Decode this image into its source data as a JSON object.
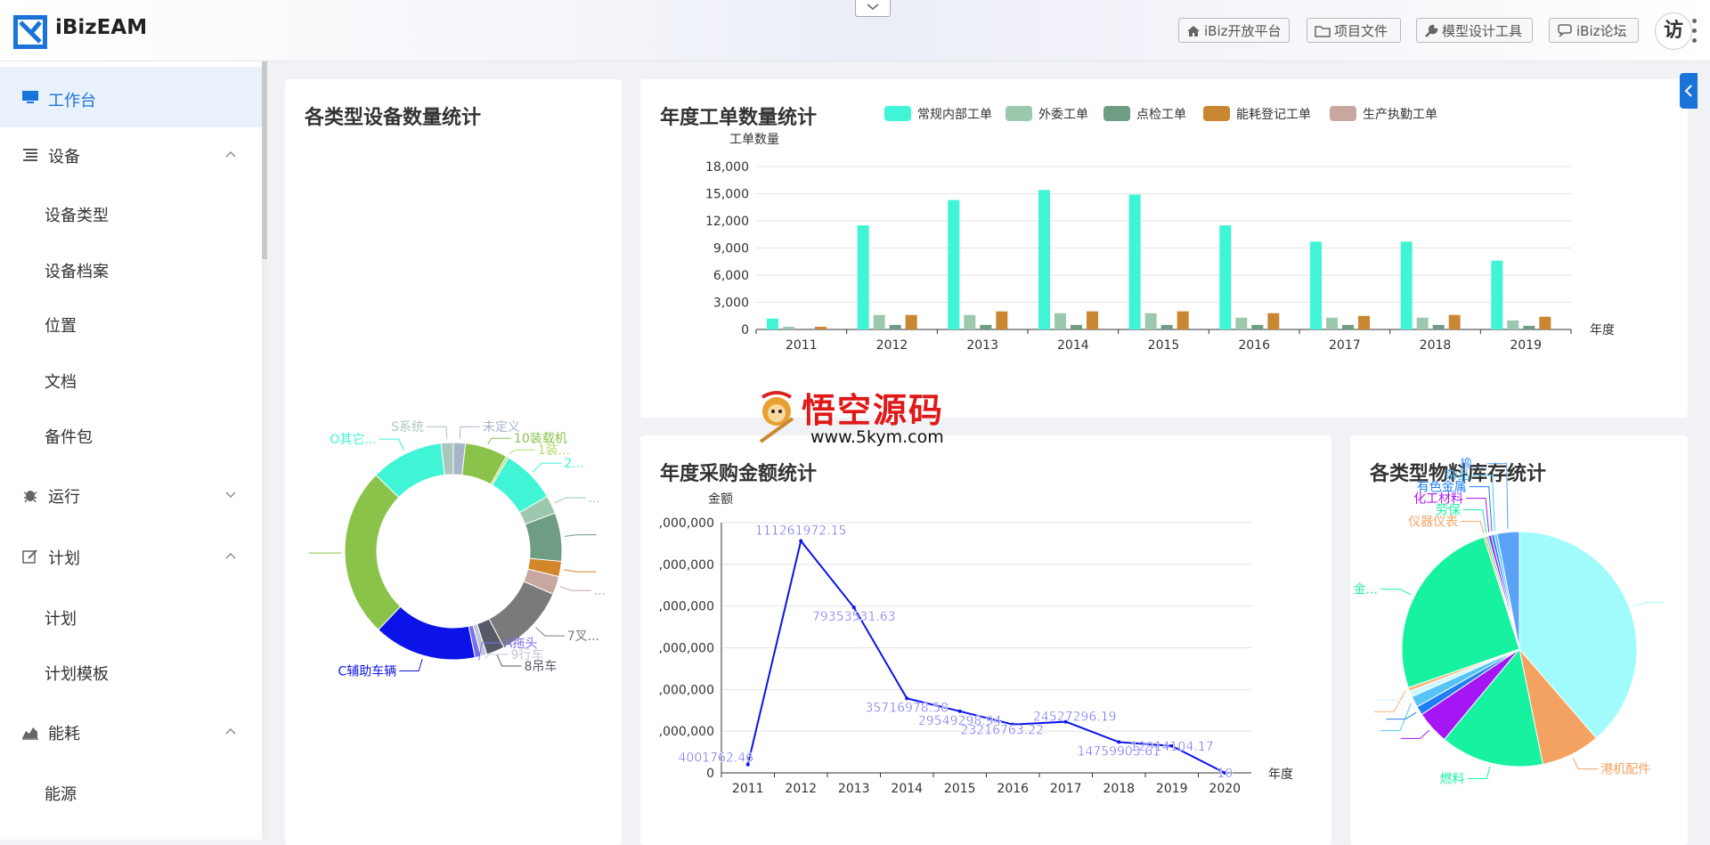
{
  "header": {
    "app_title": "iBizEAM",
    "buttons": [
      {
        "label": "iBiz开放平台",
        "icon": "home-icon"
      },
      {
        "label": "项目文件",
        "icon": "folder-icon"
      },
      {
        "label": "模型设计工具",
        "icon": "wrench-icon"
      },
      {
        "label": "iBiz论坛",
        "icon": "chat-icon"
      }
    ],
    "avatar_text": "访"
  },
  "sidebar": {
    "items": [
      {
        "label": "工作台",
        "icon": "monitor-icon",
        "active": true
      },
      {
        "label": "设备",
        "icon": "list-icon",
        "expanded": true
      },
      {
        "label": "设备类型"
      },
      {
        "label": "设备档案"
      },
      {
        "label": "位置"
      },
      {
        "label": "文档"
      },
      {
        "label": "备件包"
      },
      {
        "label": "运行",
        "icon": "bug-icon",
        "expanded": false
      },
      {
        "label": "计划",
        "icon": "edit-icon",
        "expanded": true
      },
      {
        "label": "计划"
      },
      {
        "label": "计划模板"
      },
      {
        "label": "能耗",
        "icon": "area-chart-icon",
        "expanded": true
      },
      {
        "label": "能源"
      }
    ]
  },
  "watermark": {
    "title": "悟空源码",
    "url": "www.5kym.com"
  },
  "cards": {
    "equipment_title": "各类型设备数量统计",
    "work_order_title": "年度工单数量统计",
    "purchase_title": "年度采购金额统计",
    "material_title": "各类型物料库存统计"
  },
  "chart_data": [
    {
      "type": "pie",
      "variant": "donut",
      "title": "各类型设备数量统计",
      "slices": [
        {
          "label": "未定义",
          "value": 2,
          "color": "#a7b5c9"
        },
        {
          "label": "10装载机",
          "value": 7,
          "color": "#8bc34a"
        },
        {
          "label": "1装...",
          "value": 0.4,
          "color": "#b4dc6e"
        },
        {
          "label": "2...",
          "value": 9,
          "color": "#3ff5d6"
        },
        {
          "label": "...",
          "value": 3,
          "color": "#9cc9ad"
        },
        {
          "label": "",
          "value": 8,
          "color": "#6e9d83"
        },
        {
          "label": "",
          "value": 2.5,
          "color": "#d4862b"
        },
        {
          "label": "...",
          "value": 3,
          "color": "#c8a7a0"
        },
        {
          "label": "7叉...",
          "value": 12,
          "color": "#7a7a7a"
        },
        {
          "label": "8吊车",
          "value": 3,
          "color": "#555a66"
        },
        {
          "label": "9行车",
          "value": 1,
          "color": "#c0c7d6"
        },
        {
          "label": "A拖头",
          "value": 1,
          "color": "#7a6ff0"
        },
        {
          "label": "C辅助车辆",
          "value": 17,
          "color": "#0b13e8"
        },
        {
          "label": "",
          "value": 28,
          "color": "#8bc34a"
        },
        {
          "label": "O其它...",
          "value": 12,
          "color": "#3ff5d6"
        },
        {
          "label": "S系统",
          "value": 2,
          "color": "#a9c8bb"
        }
      ]
    },
    {
      "type": "bar",
      "title": "年度工单数量统计",
      "xlabel": "年度",
      "ylabel": "工单数量",
      "categories": [
        "2011",
        "2012",
        "2013",
        "2014",
        "2015",
        "2016",
        "2017",
        "2018",
        "2019"
      ],
      "ylim": [
        0,
        18000
      ],
      "yticks": [
        "0",
        "3,000",
        "6,000",
        "9,000",
        "12,000",
        "15,000",
        "18,000"
      ],
      "legend_position": "top",
      "series": [
        {
          "name": "常规内部工单",
          "color": "#3ff5d6",
          "values": [
            1200,
            11500,
            14300,
            15400,
            14900,
            11500,
            9700,
            9700,
            7600
          ]
        },
        {
          "name": "外委工单",
          "color": "#9cc9ad",
          "values": [
            300,
            1600,
            1600,
            1800,
            1800,
            1300,
            1300,
            1300,
            1000
          ]
        },
        {
          "name": "点检工单",
          "color": "#6e9d83",
          "values": [
            0,
            500,
            500,
            500,
            500,
            500,
            500,
            500,
            400
          ]
        },
        {
          "name": "能耗登记工单",
          "color": "#c88730",
          "values": [
            300,
            1600,
            2000,
            2000,
            2000,
            1800,
            1500,
            1600,
            1400
          ]
        },
        {
          "name": "生产执勤工单",
          "color": "#c8a7a0",
          "values": [
            0,
            0,
            0,
            0,
            0,
            0,
            0,
            0,
            0
          ]
        }
      ]
    },
    {
      "type": "line",
      "title": "年度采购金额统计",
      "xlabel": "年度",
      "ylabel": "金额",
      "x": [
        "2011",
        "2012",
        "2013",
        "2014",
        "2015",
        "2016",
        "2017",
        "2018",
        "2019",
        "2020"
      ],
      "ylim": [
        0,
        120000000
      ],
      "yticks": [
        "0",
        ",000,000",
        ",000,000",
        ",000,000",
        ",000,000",
        ",000,000",
        ",000,000"
      ],
      "series": [
        {
          "name": "",
          "color": "#0b13e8",
          "values": [
            4001762.46,
            111261972.15,
            79353531.63,
            35716978.58,
            29549298.94,
            23216763.22,
            24527296.19,
            14759903.61,
            12914104.17,
            10
          ],
          "labels": [
            "4001762.46",
            "111261972.15",
            "79353531.63",
            "35716978.58",
            "29549298.94",
            "23216763.22",
            "24527296.19",
            "14759903.61",
            "12914104.17",
            "10"
          ]
        }
      ]
    },
    {
      "type": "pie",
      "title": "各类型物料库存统计",
      "slices": [
        {
          "label": "",
          "value": 38,
          "color": "#a2fbfb"
        },
        {
          "label": "港机配件",
          "value": 8,
          "color": "#f4a261"
        },
        {
          "label": "燃料",
          "value": 14,
          "color": "#17f2a0"
        },
        {
          "label": "",
          "value": 4.5,
          "color": "#a516f5"
        },
        {
          "label": "",
          "value": 1.2,
          "color": "#1e7ff4"
        },
        {
          "label": "",
          "value": 1.5,
          "color": "#58c3f7"
        },
        {
          "label": "",
          "value": 0.8,
          "color": "#d0f7ff"
        },
        {
          "label": "",
          "value": 0.5,
          "color": "#f6b47a"
        },
        {
          "label": "金...",
          "value": 25,
          "color": "#17f2a0"
        },
        {
          "label": "仪器仪表",
          "value": 0.3,
          "color": "#f4a261"
        },
        {
          "label": "劳保",
          "value": 0.3,
          "color": "#17f2a0"
        },
        {
          "label": "化工材料",
          "value": 0.4,
          "color": "#a516f5"
        },
        {
          "label": "有色金属",
          "value": 0.4,
          "color": "#1e7ff4"
        },
        {
          "label": "杂品",
          "value": 0.4,
          "color": "#58c3f7"
        },
        {
          "label": "橡...",
          "value": 3,
          "color": "#5aa3f7"
        }
      ]
    }
  ]
}
